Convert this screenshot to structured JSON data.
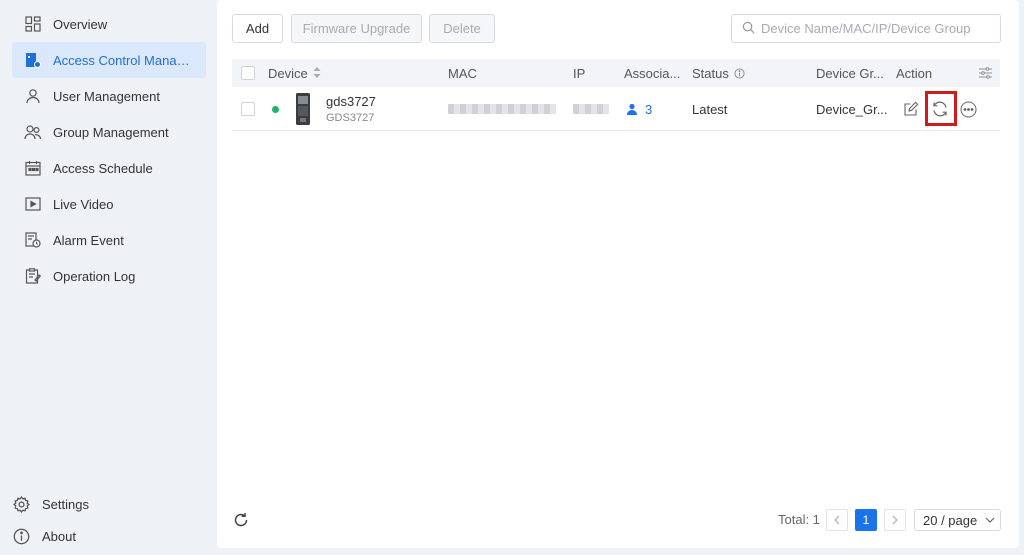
{
  "sidebar": {
    "items": [
      {
        "label": "Overview",
        "icon": "overview-icon"
      },
      {
        "label": "Access Control Manag...",
        "icon": "access-control-icon",
        "active": true
      },
      {
        "label": "User Management",
        "icon": "user-icon"
      },
      {
        "label": "Group Management",
        "icon": "group-icon"
      },
      {
        "label": "Access Schedule",
        "icon": "calendar-icon"
      },
      {
        "label": "Live Video",
        "icon": "video-icon"
      },
      {
        "label": "Alarm Event",
        "icon": "alarm-icon"
      },
      {
        "label": "Operation Log",
        "icon": "log-icon"
      }
    ],
    "settings_label": "Settings",
    "about_label": "About"
  },
  "toolbar": {
    "add_label": "Add",
    "firmware_label": "Firmware Upgrade",
    "delete_label": "Delete",
    "search_placeholder": "Device Name/MAC/IP/Device Group"
  },
  "table": {
    "headers": {
      "device": "Device",
      "mac": "MAC",
      "ip": "IP",
      "associated": "Associa...",
      "status": "Status",
      "device_group": "Device Gr...",
      "action": "Action"
    },
    "rows": [
      {
        "name": "gds3727",
        "model": "GDS3727",
        "online_color": "#1fb36b",
        "associated_count": "3",
        "status": "Latest",
        "device_group": "Device_Gr..."
      }
    ]
  },
  "footer": {
    "total_label": "Total: 1",
    "current_page": "1",
    "page_size": "20 / page"
  },
  "colors": {
    "accent": "#1a73e8",
    "highlight_box": "#d11a1a",
    "online": "#1fb36b"
  }
}
